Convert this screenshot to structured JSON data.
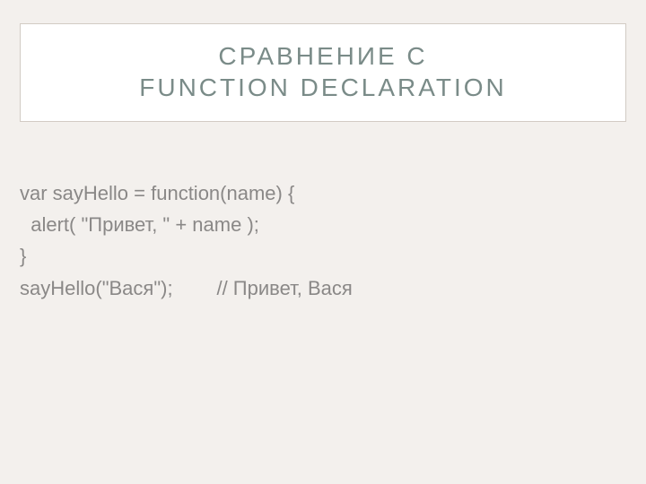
{
  "slide": {
    "title": "СРАВНЕНИЕ С\nFUNCTION DECLARATION",
    "lines": [
      "var sayHello = function(name) {",
      "  alert( \"Привет, \" + name );",
      "}",
      "",
      "sayHello(\"Вася\");        // Привет, Вася"
    ]
  }
}
